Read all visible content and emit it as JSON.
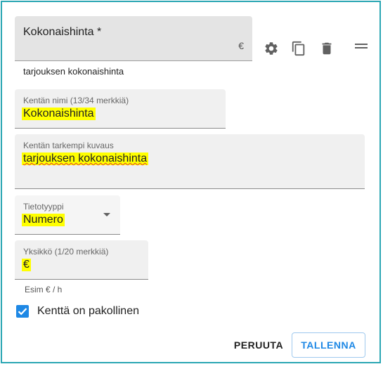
{
  "preview": {
    "label": "Kokonaishinta *",
    "suffix": "€",
    "helper": "tarjouksen kokonaishinta"
  },
  "toolbar": {
    "settings_icon": "gear-icon",
    "copy_icon": "copy-icon",
    "delete_icon": "trash-icon",
    "drag_icon": "drag-handle-icon"
  },
  "fields": {
    "name": {
      "label": "Kentän nimi (13/34 merkkiä)",
      "value": "Kokonaishinta"
    },
    "description": {
      "label": "Kentän tarkempi kuvaus",
      "value": "tarjouksen kokonaishinta"
    },
    "type": {
      "label": "Tietotyyppi",
      "value": "Numero"
    },
    "unit": {
      "label": "Yksikkö (1/20 merkkiä)",
      "value": "€",
      "helper": "Esim € / h"
    }
  },
  "required_checkbox": {
    "label": "Kenttä on pakollinen",
    "checked": true
  },
  "buttons": {
    "cancel": "PERUUTA",
    "save": "TALLENNA"
  },
  "colors": {
    "accent": "#1e88e5",
    "frame": "#2aa6b3",
    "highlight": "#ffff00"
  }
}
